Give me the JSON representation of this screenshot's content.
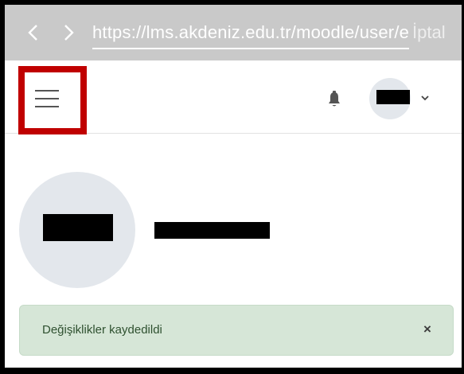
{
  "browser": {
    "back_glyph": "‹",
    "forward_glyph": "›",
    "url": "https://lms.akdeniz.edu.tr/moodle/user/edit.php",
    "cancel_label": "İptal"
  },
  "navbar": {
    "menu_icon": "hamburger-menu-icon",
    "notification_icon": "bell-icon",
    "user_menu_icon": "chevron-down-icon"
  },
  "alert": {
    "message": "Değişiklikler kaydedildi",
    "close_glyph": "×"
  },
  "colors": {
    "highlight": "#c00000",
    "alert_background": "#d6e6d7",
    "urlbar_background": "#c9c9c9"
  }
}
